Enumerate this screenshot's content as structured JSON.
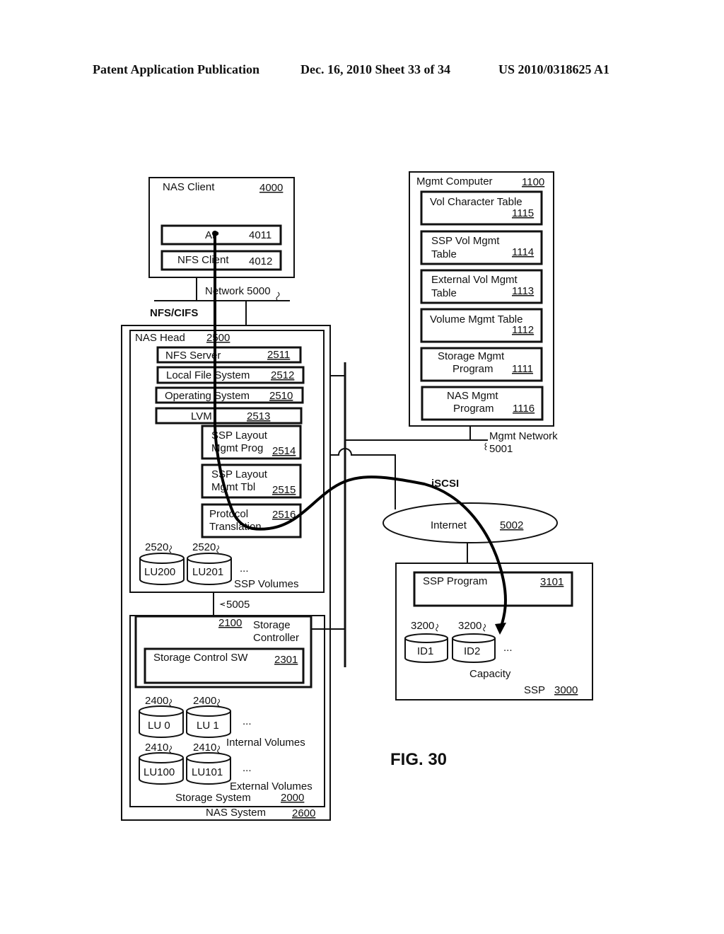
{
  "header": {
    "publication": "Patent Application Publication",
    "date_sheet": "Dec. 16, 2010   Sheet 33 of 34",
    "patent_number": "US 2010/0318625 A1"
  },
  "figure_label": "FIG. 30",
  "nas_client": {
    "title": "NAS Client",
    "ref": "4000",
    "ap": {
      "label": "AP",
      "ref": "4011"
    },
    "nfs_client": {
      "label": "NFS Client",
      "ref": "4012"
    }
  },
  "network": {
    "label": "Network 5000",
    "protocol": "NFS/CIFS"
  },
  "nas_head": {
    "title": "NAS Head",
    "ref": "2500",
    "components": [
      {
        "label": "NFS Server",
        "ref": "2511"
      },
      {
        "label": "Local File System",
        "ref": "2512"
      },
      {
        "label": "Operating System",
        "ref": "2510"
      },
      {
        "label": "LVM",
        "ref": "2513"
      }
    ],
    "ssp_layout_prog": {
      "line1": "SSP Layout",
      "line2": "Mgmt Prog",
      "ref": "2514"
    },
    "ssp_layout_tbl": {
      "line1": "SSP Layout",
      "line2": "Mgmt Tbl",
      "ref": "2515"
    },
    "protocol_translation": {
      "line1": "Protocol",
      "line2": "Translation",
      "ref": "2516"
    },
    "ssp_volumes": {
      "label": "SSP Volumes",
      "ellipsis": "...",
      "items": [
        {
          "label": "LU200",
          "ref": "2520"
        },
        {
          "label": "LU201",
          "ref": "2520"
        }
      ]
    }
  },
  "link_5005": "5005",
  "storage_system": {
    "title": "Storage System",
    "ref": "2000",
    "controller": {
      "line1": "Storage",
      "line2": "Controller",
      "ref": "2100"
    },
    "control_sw": {
      "label": "Storage Control SW",
      "ref": "2301"
    },
    "internal_volumes": {
      "label": "Internal Volumes",
      "ellipsis": "...",
      "items": [
        {
          "label": "LU 0",
          "ref": "2400"
        },
        {
          "label": "LU 1",
          "ref": "2400"
        }
      ]
    },
    "external_volumes": {
      "label": "External Volumes",
      "ellipsis": "...",
      "items": [
        {
          "label": "LU100",
          "ref": "2410"
        },
        {
          "label": "LU101",
          "ref": "2410"
        }
      ]
    }
  },
  "nas_system": {
    "title": "NAS System",
    "ref": "2600"
  },
  "mgmt_computer": {
    "title": "Mgmt Computer",
    "ref": "1100",
    "items": [
      {
        "line1": "Vol Character Table",
        "line2": "",
        "ref": "1115"
      },
      {
        "line1": "SSP Vol Mgmt",
        "line2": "Table",
        "ref": "1114"
      },
      {
        "line1": "External Vol Mgmt",
        "line2": "Table",
        "ref": "1113"
      },
      {
        "line1": "Volume Mgmt Table",
        "line2": "",
        "ref": "1112"
      },
      {
        "line1": "Storage Mgmt",
        "line2": "Program",
        "ref": "1111"
      },
      {
        "line1": "NAS Mgmt",
        "line2": "Program",
        "ref": "1116"
      }
    ]
  },
  "mgmt_network": {
    "label": "Mgmt Network",
    "ref": "5001"
  },
  "iscsi_label": "iSCSI",
  "internet": {
    "label": "Internet",
    "ref": "5002"
  },
  "ssp": {
    "title": "SSP",
    "ref": "3000",
    "program": {
      "label": "SSP Program",
      "ref": "3101"
    },
    "capacity": {
      "label": "Capacity",
      "ellipsis": "...",
      "items": [
        {
          "label": "ID1",
          "ref": "3200"
        },
        {
          "label": "ID2",
          "ref": "3200"
        }
      ]
    }
  }
}
